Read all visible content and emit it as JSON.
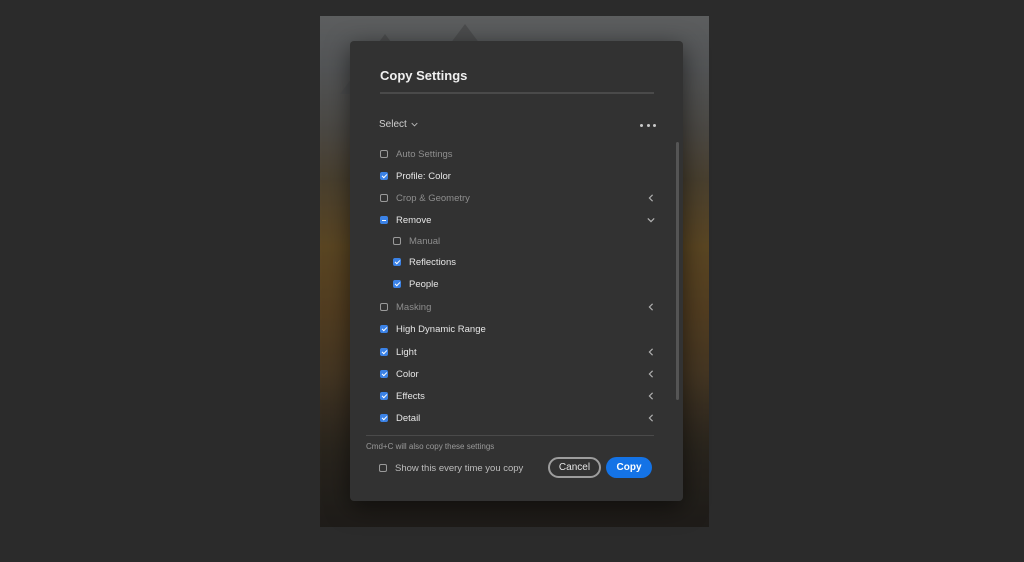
{
  "dialog": {
    "title": "Copy Settings",
    "select_label": "Select",
    "items": [
      {
        "label": "Auto Settings",
        "state": "unchecked",
        "dim": true,
        "arrow": "none"
      },
      {
        "label": "Profile: Color",
        "state": "checked",
        "dim": false,
        "arrow": "none"
      },
      {
        "label": "Crop & Geometry",
        "state": "unchecked",
        "dim": true,
        "arrow": "left"
      },
      {
        "label": "Remove",
        "state": "partial",
        "dim": false,
        "arrow": "down"
      },
      {
        "label": "Manual",
        "state": "unchecked",
        "dim": true,
        "arrow": "none",
        "indent": true
      },
      {
        "label": "Reflections",
        "state": "checked",
        "dim": false,
        "arrow": "none",
        "indent": true
      },
      {
        "label": "People",
        "state": "checked",
        "dim": false,
        "arrow": "none",
        "indent": true
      },
      {
        "label": "Masking",
        "state": "unchecked",
        "dim": true,
        "arrow": "left"
      },
      {
        "label": "High Dynamic Range",
        "state": "checked",
        "dim": false,
        "arrow": "none"
      },
      {
        "label": "Light",
        "state": "checked",
        "dim": false,
        "arrow": "left"
      },
      {
        "label": "Color",
        "state": "checked",
        "dim": false,
        "arrow": "left"
      },
      {
        "label": "Effects",
        "state": "checked",
        "dim": false,
        "arrow": "left"
      },
      {
        "label": "Detail",
        "state": "checked",
        "dim": false,
        "arrow": "left"
      }
    ],
    "hint": "Cmd+C will also copy these settings",
    "show_every_time": {
      "label": "Show this every time you copy",
      "checked": false
    },
    "cancel_label": "Cancel",
    "copy_label": "Copy"
  },
  "colors": {
    "accent": "#1473e6",
    "checkbox_checked": "#3b82e6",
    "dialog_bg": "#323232",
    "app_bg": "#2b2b2b"
  }
}
